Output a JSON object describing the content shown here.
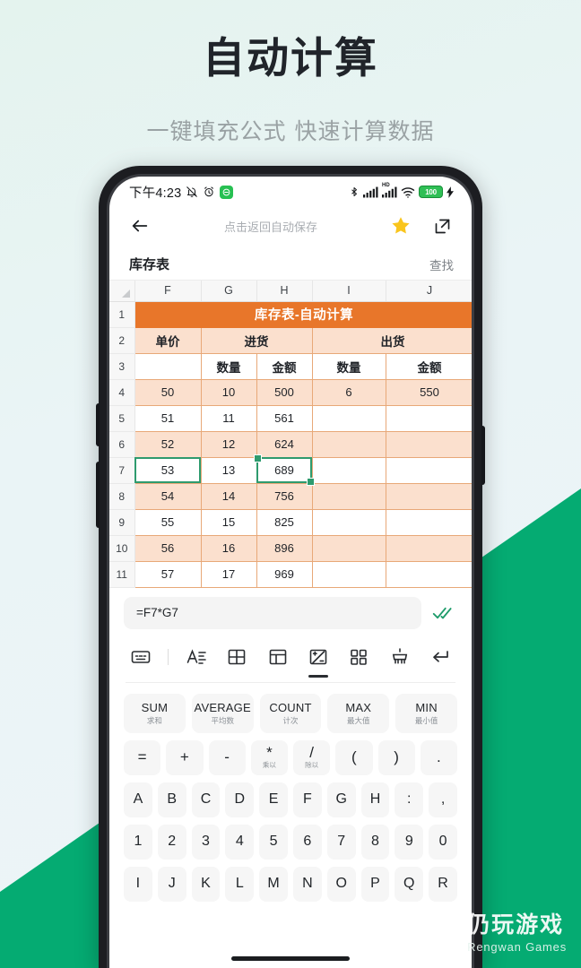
{
  "headline": {
    "title": "自动计算",
    "subtitle": "一键填充公式 快速计算数据"
  },
  "colors": {
    "background_light": "#e8f5f1",
    "brand_green": "#05ab72",
    "sheet_accent_orange": "#e8762a",
    "sheet_tint": "#fbe0ce",
    "selection_green": "#2e9b6e",
    "star_yellow": "#f9c51d"
  },
  "status_bar": {
    "time": "下午4:23",
    "icons_left": [
      "mute-bell-icon",
      "alarm-clock-icon",
      "dnd-badge-icon"
    ],
    "icons_right": [
      "bluetooth-icon",
      "signal-icon",
      "hd-signal-icon",
      "wifi-icon",
      "battery-icon",
      "charging-bolt-icon"
    ],
    "battery_level": "100"
  },
  "app_topbar": {
    "back_icon": "back-arrow-icon",
    "autosave_hint": "点击返回自动保存",
    "star_icon": "star-icon",
    "share_icon": "share-external-icon"
  },
  "sheet_header": {
    "name": "库存表",
    "find_label": "查找"
  },
  "spreadsheet": {
    "corner_icon": "select-all-triangle-icon",
    "columns": [
      "F",
      "G",
      "H",
      "I",
      "J"
    ],
    "rows": [
      {
        "num": "1",
        "type": "title-band",
        "title": "库存表-自动计算"
      },
      {
        "num": "2",
        "type": "group-header",
        "cells": [
          "单价",
          "进货",
          "",
          "出货",
          ""
        ]
      },
      {
        "num": "3",
        "type": "sub-header",
        "cells": [
          "",
          "数量",
          "金额",
          "数量",
          "金额"
        ]
      },
      {
        "num": "4",
        "type": "data",
        "tint": true,
        "cells": [
          "50",
          "10",
          "500",
          "6",
          "550"
        ]
      },
      {
        "num": "5",
        "type": "data",
        "tint": false,
        "cells": [
          "51",
          "11",
          "561",
          "",
          ""
        ]
      },
      {
        "num": "6",
        "type": "data",
        "tint": true,
        "cells": [
          "52",
          "12",
          "624",
          "",
          ""
        ]
      },
      {
        "num": "7",
        "type": "data",
        "tint": false,
        "cells": [
          "53",
          "13",
          "689",
          "",
          ""
        ]
      },
      {
        "num": "8",
        "type": "data",
        "tint": true,
        "cells": [
          "54",
          "14",
          "756",
          "",
          ""
        ]
      },
      {
        "num": "9",
        "type": "data",
        "tint": false,
        "cells": [
          "55",
          "15",
          "825",
          "",
          ""
        ]
      },
      {
        "num": "10",
        "type": "data",
        "tint": true,
        "cells": [
          "56",
          "16",
          "896",
          "",
          ""
        ]
      },
      {
        "num": "11",
        "type": "data",
        "tint": false,
        "cells": [
          "57",
          "17",
          "969",
          "",
          ""
        ]
      }
    ],
    "selection": {
      "anchor_cell": "F7",
      "range": "H7",
      "handle_icon": "fill-handle-icon"
    }
  },
  "formula_bar": {
    "value": "=F7*G7",
    "placeholder": "",
    "confirm_icon": "double-check-icon"
  },
  "icon_toolbar": {
    "items": [
      {
        "name": "keyboard-icon",
        "active": false
      },
      {
        "name": "text-format-icon",
        "active": false
      },
      {
        "name": "table-grid-icon",
        "active": false
      },
      {
        "name": "layout-icon",
        "active": false
      },
      {
        "name": "formula-calc-icon",
        "active": true
      },
      {
        "name": "apps-grid-icon",
        "active": false
      },
      {
        "name": "clear-brush-icon",
        "active": false
      },
      {
        "name": "enter-return-icon",
        "active": false
      }
    ]
  },
  "function_chips": [
    {
      "en": "SUM",
      "cn": "求和"
    },
    {
      "en": "AVERAGE",
      "cn": "平均数"
    },
    {
      "en": "COUNT",
      "cn": "计次"
    },
    {
      "en": "MAX",
      "cn": "最大值"
    },
    {
      "en": "MIN",
      "cn": "最小值"
    }
  ],
  "keyboard": {
    "operator_row": [
      {
        "main": "=",
        "sub": ""
      },
      {
        "main": "+",
        "sub": ""
      },
      {
        "main": "-",
        "sub": ""
      },
      {
        "main": "*",
        "sub": "乘以"
      },
      {
        "main": "/",
        "sub": "除以"
      },
      {
        "main": "(",
        "sub": ""
      },
      {
        "main": ")",
        "sub": ""
      },
      {
        "main": ".",
        "sub": ""
      }
    ],
    "letter_row_1": [
      "A",
      "B",
      "C",
      "D",
      "E",
      "F",
      "G",
      "H",
      ":",
      ","
    ],
    "number_row": [
      "1",
      "2",
      "3",
      "4",
      "5",
      "6",
      "7",
      "8",
      "9",
      "0"
    ],
    "letter_row_2": [
      "I",
      "J",
      "K",
      "L",
      "M",
      "N",
      "O",
      "P",
      "Q",
      "R"
    ]
  },
  "watermark": {
    "cn": "仍玩游戏",
    "en": "Rengwan Games",
    "logo_icon": "rengwan-logo-icon"
  }
}
